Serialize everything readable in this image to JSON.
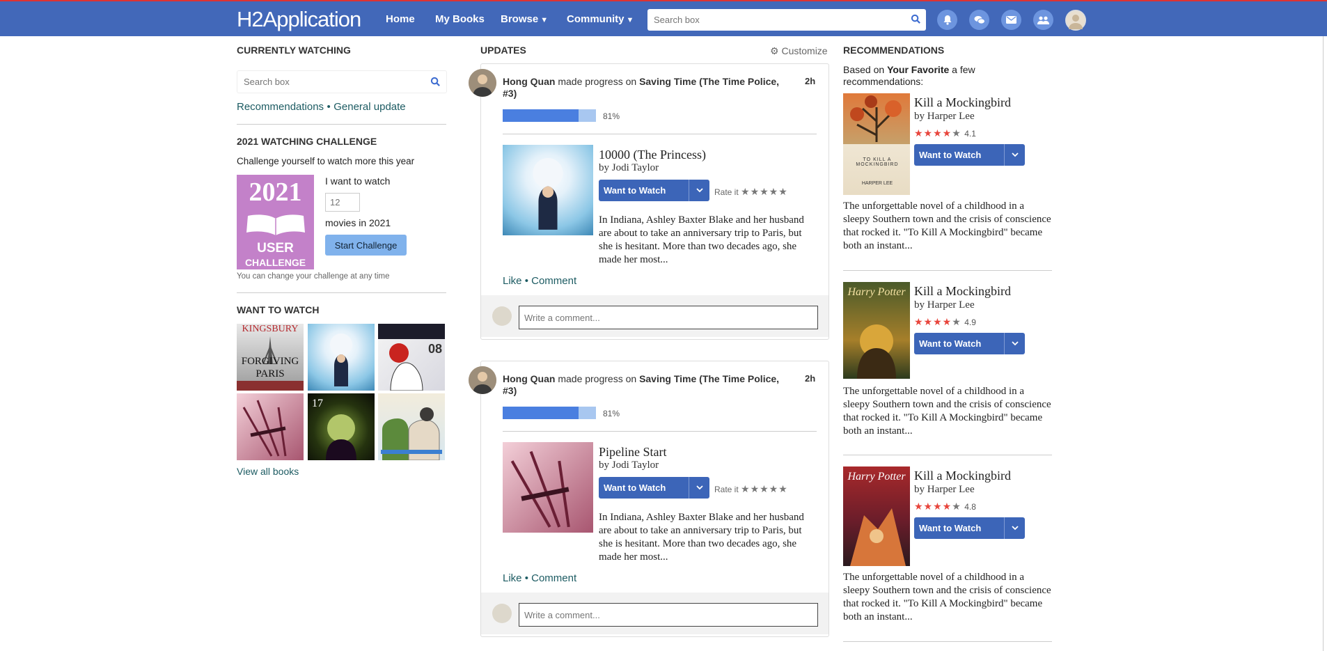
{
  "header": {
    "logo": "H2Application",
    "nav": [
      "Home",
      "My Books",
      "Browse",
      "Community"
    ],
    "search_placeholder": "Search box"
  },
  "left": {
    "watching_title": "CURRENTLY WATCHING",
    "search_placeholder": "Search box",
    "rec_link": "Recommendations",
    "sep": "•",
    "general_link": "General update",
    "challenge_title": "2021 WATCHING CHALLENGE",
    "challenge_sub": "Challenge yourself to watch more this year",
    "badge_year": "2021",
    "badge_user": "USER",
    "badge_challenge": "CHALLENGE",
    "want_label": "I want to watch",
    "want_value": "12",
    "movies_label": "movies in 2021",
    "start_button": "Start Challenge",
    "change_note": "You can change your challenge at any time",
    "want_title": "WANT TO WATCH",
    "view_all": "View all books"
  },
  "updates": {
    "title": "UPDATES",
    "customize": "Customize",
    "items": [
      {
        "user": "Hong Quan",
        "action": "made progress on",
        "target": "Saving Time (The Time Police, #3)",
        "time": "2h",
        "progress": 81,
        "progress_label": "81%",
        "book_title": "10000 (The Princess)",
        "book_by": "by Jodi Taylor",
        "watch_button": "Want to Watch",
        "rate_label": "Rate it",
        "desc": "In Indiana, Ashley Baxter Blake and her husband are about to take an anniversary trip to Paris, but she is hesitant. More than two decades ago, she made her most...",
        "like": "Like",
        "comment": "Comment",
        "comment_placeholder": "Write a comment..."
      },
      {
        "user": "Hong Quan",
        "action": "made progress on",
        "target": "Saving Time (The Time Police, #3)",
        "time": "2h",
        "progress": 81,
        "progress_label": "81%",
        "book_title": "Pipeline Start",
        "book_by": "by Jodi Taylor",
        "watch_button": "Want to Watch",
        "rate_label": "Rate it",
        "desc": "In Indiana, Ashley Baxter Blake and her husband are about to take an anniversary trip to Paris, but she is hesitant. More than two decades ago, she made her most...",
        "like": "Like",
        "comment": "Comment",
        "comment_placeholder": "Write a comment..."
      }
    ]
  },
  "recs": {
    "title": "RECOMMENDATIONS",
    "based_prefix": "Based on",
    "based_bold": "Your Favorite",
    "based_suffix": "a few recommendations:",
    "items": [
      {
        "title": "Kill a Mockingbird",
        "by_prefix": "by",
        "author": "Harper Lee",
        "rating": "4.1",
        "button": "Want to Watch",
        "desc": "The unforgettable novel of a childhood in a sleepy Southern town and the crisis of conscience that rocked it. \"To Kill A Mockingbird\" became both an instant..."
      },
      {
        "title": "Kill a Mockingbird",
        "by_prefix": "by",
        "author": "Harper Lee",
        "rating": "4.9",
        "button": "Want to Watch",
        "desc": "The unforgettable novel of a childhood in a sleepy Southern town and the crisis of conscience that rocked it. \"To Kill A Mockingbird\" became both an instant..."
      },
      {
        "title": "Kill a Mockingbird",
        "by_prefix": "by",
        "author": "Harper Lee",
        "rating": "4.8",
        "button": "Want to Watch",
        "desc": "The unforgettable novel of a childhood in a sleepy Southern town and the crisis of conscience that rocked it. \"To Kill A Mockingbird\" became both an instant..."
      }
    ]
  },
  "covers": {
    "forgiving_paris": [
      "KINGSBURY",
      "FORGIVING",
      "PARIS"
    ],
    "manga_number": "17",
    "manga_vol": "08",
    "hp_brand": "Harry Potter",
    "mock_text": "TO KILL A MOCKINGBIRD",
    "mock_author": "HARPER LEE"
  }
}
